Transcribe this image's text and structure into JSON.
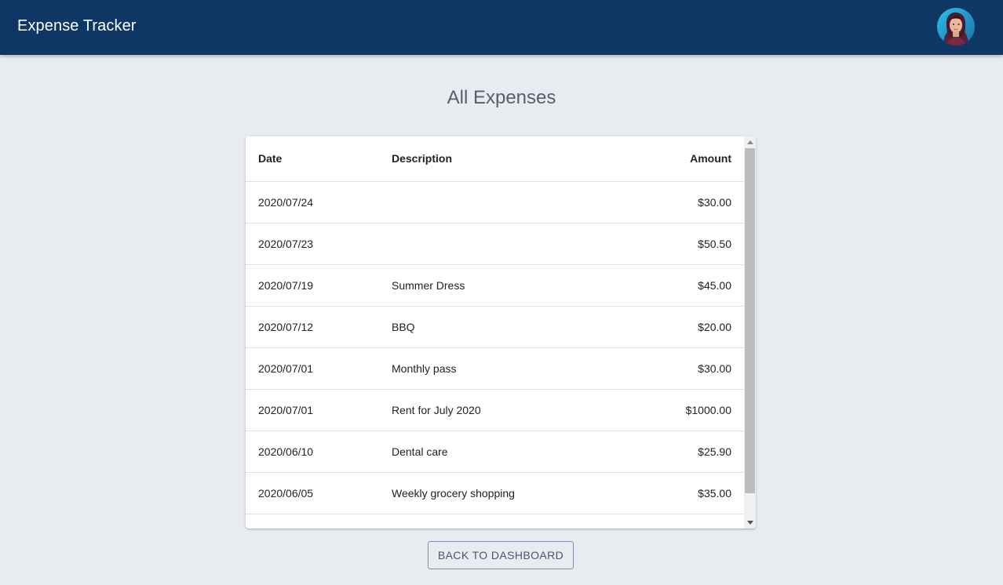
{
  "header": {
    "app_title": "Expense Tracker",
    "avatar_icon": "user-avatar-icon",
    "background_color": "#0f3766"
  },
  "main": {
    "page_title": "All Expenses",
    "table": {
      "columns": {
        "date": "Date",
        "description": "Description",
        "amount": "Amount"
      },
      "rows": [
        {
          "date": "2020/07/24",
          "description": "",
          "amount": "$30.00"
        },
        {
          "date": "2020/07/23",
          "description": "",
          "amount": "$50.50"
        },
        {
          "date": "2020/07/19",
          "description": "Summer Dress",
          "amount": "$45.00"
        },
        {
          "date": "2020/07/12",
          "description": "BBQ",
          "amount": "$20.00"
        },
        {
          "date": "2020/07/01",
          "description": "Monthly pass",
          "amount": "$30.00"
        },
        {
          "date": "2020/07/01",
          "description": "Rent for July 2020",
          "amount": "$1000.00"
        },
        {
          "date": "2020/06/10",
          "description": "Dental care",
          "amount": "$25.90"
        },
        {
          "date": "2020/06/05",
          "description": "Weekly grocery shopping",
          "amount": "$35.00"
        },
        {
          "date": "",
          "description": "",
          "amount": ""
        }
      ]
    },
    "back_button_label": "BACK TO DASHBOARD"
  }
}
